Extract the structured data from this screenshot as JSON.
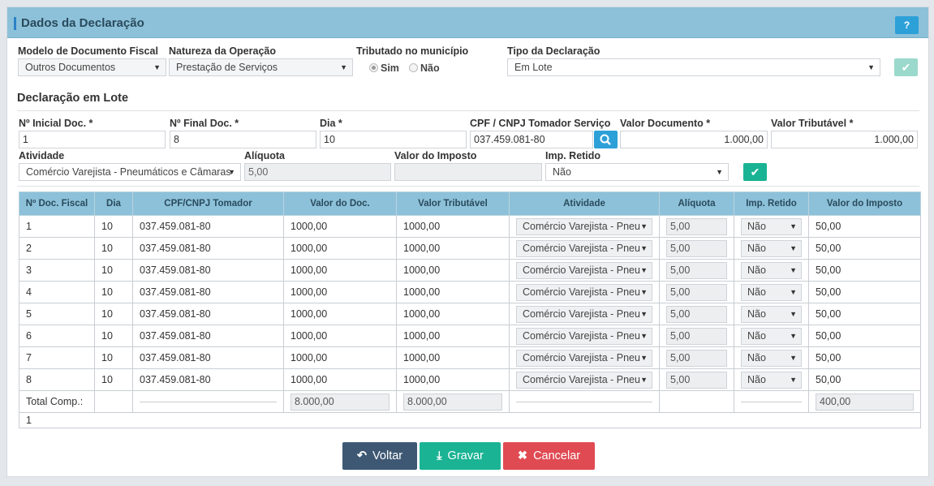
{
  "header": {
    "title": "Dados da Declaração",
    "help_label": "?"
  },
  "form": {
    "modelo": {
      "label": "Modelo de Documento Fiscal",
      "value": "Outros Documentos"
    },
    "natureza": {
      "label": "Natureza da Operação",
      "value": "Prestação de Serviços"
    },
    "tributado": {
      "label": "Tributado no município",
      "sim": "Sim",
      "nao": "Não",
      "selected": "Sim"
    },
    "tipo": {
      "label": "Tipo da Declaração",
      "value": "Em Lote"
    }
  },
  "lote": {
    "title": "Declaração em Lote",
    "inicial": {
      "label": "Nº Inicial Doc. *",
      "value": "1"
    },
    "final": {
      "label": "Nº Final Doc. *",
      "value": "8"
    },
    "dia": {
      "label": "Dia *",
      "value": "10"
    },
    "cpf": {
      "label": "CPF / CNPJ Tomador Serviço",
      "value": "037.459.081-80"
    },
    "valor_doc": {
      "label": "Valor Documento *",
      "value": "1.000,00"
    },
    "valor_trib": {
      "label": "Valor Tributável *",
      "value": "1.000,00"
    },
    "atividade": {
      "label": "Atividade",
      "value": "Comércio Varejista - Pneumáticos e Câmaras"
    },
    "aliquota": {
      "label": "Alíquota",
      "value": "5,00"
    },
    "imposto": {
      "label": "Valor do Imposto",
      "value": ""
    },
    "retido": {
      "label": "Imp. Retido",
      "value": "Não"
    }
  },
  "table": {
    "headers": [
      "Nº Doc. Fiscal",
      "Dia",
      "CPF/CNPJ Tomador",
      "Valor do Doc.",
      "Valor Tributável",
      "Atividade",
      "Alíquota",
      "Imp. Retido",
      "Valor do Imposto"
    ],
    "rows": [
      [
        "1",
        "10",
        "037.459.081-80",
        "1000,00",
        "1000,00",
        "Comércio Varejista - Pneu",
        "5,00",
        "Não",
        "50,00"
      ],
      [
        "2",
        "10",
        "037.459.081-80",
        "1000,00",
        "1000,00",
        "Comércio Varejista - Pneu",
        "5,00",
        "Não",
        "50,00"
      ],
      [
        "3",
        "10",
        "037.459.081-80",
        "1000,00",
        "1000,00",
        "Comércio Varejista - Pneu",
        "5,00",
        "Não",
        "50,00"
      ],
      [
        "4",
        "10",
        "037.459.081-80",
        "1000,00",
        "1000,00",
        "Comércio Varejista - Pneu",
        "5,00",
        "Não",
        "50,00"
      ],
      [
        "5",
        "10",
        "037.459.081-80",
        "1000,00",
        "1000,00",
        "Comércio Varejista - Pneu",
        "5,00",
        "Não",
        "50,00"
      ],
      [
        "6",
        "10",
        "037.459.081-80",
        "1000,00",
        "1000,00",
        "Comércio Varejista - Pneu",
        "5,00",
        "Não",
        "50,00"
      ],
      [
        "7",
        "10",
        "037.459.081-80",
        "1000,00",
        "1000,00",
        "Comércio Varejista - Pneu",
        "5,00",
        "Não",
        "50,00"
      ],
      [
        "8",
        "10",
        "037.459.081-80",
        "1000,00",
        "1000,00",
        "Comércio Varejista - Pneu",
        "5,00",
        "Não",
        "50,00"
      ]
    ],
    "total": {
      "label": "Total Comp.:",
      "valor_doc": "8.000,00",
      "valor_trib": "8.000,00",
      "imposto": "400,00"
    },
    "footer": "1"
  },
  "actions": {
    "voltar": "Voltar",
    "gravar": "Gravar",
    "cancelar": "Cancelar"
  },
  "colors": {
    "header_bg": "#8cc1d9",
    "primary": "#2da0d8",
    "success": "#1ab394",
    "danger": "#e04a52",
    "dark": "#3e5874"
  }
}
